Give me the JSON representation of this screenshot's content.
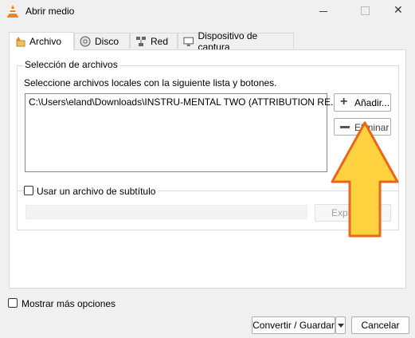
{
  "window": {
    "title": "Abrir medio"
  },
  "tabs": [
    {
      "label": "Archivo",
      "icon": "file-icon",
      "active": true
    },
    {
      "label": "Disco",
      "icon": "disc-icon",
      "active": false
    },
    {
      "label": "Red",
      "icon": "network-icon",
      "active": false
    },
    {
      "label": "Dispositivo de captura",
      "icon": "capture-device-icon",
      "active": false
    }
  ],
  "file_selection": {
    "group_label": "Selección de archivos",
    "instructions": "Seleccione archivos locales con la siguiente lista y botones.",
    "files": [
      "C:\\Users\\eland\\Downloads\\INSTRU-MENTAL TWO (ATTRIBUTION RE..."
    ],
    "add_label": "Añadir...",
    "remove_label": "Eliminar"
  },
  "subtitle": {
    "checkbox_label": "Usar un archivo de subtítulo",
    "checked": false,
    "path_value": "",
    "browse_label": "Explorar..."
  },
  "footer": {
    "more_options_label": "Mostrar más opciones",
    "more_options_checked": false,
    "convert_label": "Convertir / Guardar",
    "cancel_label": "Cancelar"
  },
  "colors": {
    "arrow_fill": "#ffd23f",
    "arrow_stroke": "#e8671c",
    "vlc_orange": "#f58220"
  }
}
